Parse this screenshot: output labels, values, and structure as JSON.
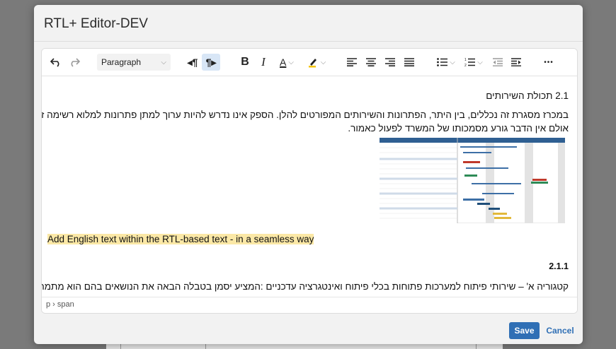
{
  "dialog": {
    "title": "RTL+ Editor-DEV"
  },
  "toolbar": {
    "format_select": "Paragraph",
    "more": "•••"
  },
  "content": {
    "heading": "2.1 תכולת השירותים",
    "paragraph1_line1": "במכרז מסגרת זה נכללים, בין היתר, הפתרונות והשירותים המפורטים להלן. הספק אינו נדרש להיות ערוך למתן פתרונות למלוא רשימה זו,",
    "paragraph1_line2": "אולם אין הדבר גורע מסמכותו של המשרד לפעול כאמור.",
    "english_highlight": "Add English text within the RTL-based text - in a seamless way",
    "section_number": "2.1.1",
    "category_line": "קטגוריה א' – שירותי פיתוח למערכות פתוחות בכלי פיתוח ואינטגרציה עדכניים :המציע יסמן בטבלה הבאה את הנושאים בהם הוא מתמחה",
    "highlight_color": "#fbe8a6"
  },
  "statusbar": {
    "path": "p › span"
  },
  "footer": {
    "save": "Save",
    "cancel": "Cancel"
  },
  "colors": {
    "accent": "#2f6fb5",
    "active_button": "#d8e6f6"
  }
}
